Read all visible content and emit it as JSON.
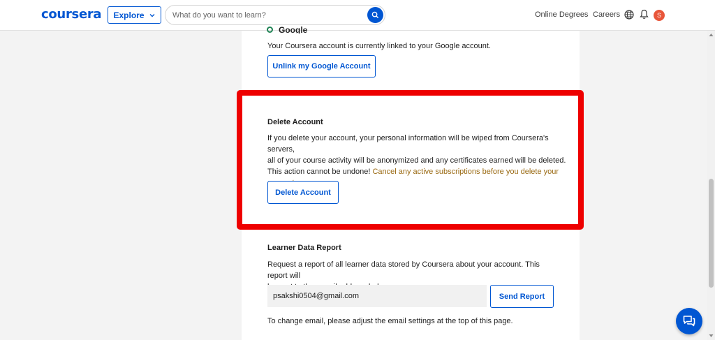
{
  "header": {
    "logo": "coursera",
    "explore_label": "Explore",
    "search_placeholder": "What do you want to learn?",
    "nav": {
      "online_degrees": "Online Degrees",
      "careers": "Careers"
    },
    "avatar_initial": "S"
  },
  "google_section": {
    "provider": "Google",
    "linked_text": "Your Coursera account is currently linked to your Google account.",
    "unlink_label": "Unlink my Google Account"
  },
  "delete_section": {
    "title": "Delete Account",
    "desc_line1": "If you delete your account, your personal information will be wiped from Coursera's servers,",
    "desc_line2": "all of your course activity will be anonymized and any certificates earned will be deleted.",
    "desc_line3": "This action cannot be undone! ",
    "desc_warning": "Cancel any active subscriptions before you delete your account.",
    "button_label": "Delete Account"
  },
  "report_section": {
    "title": "Learner Data Report",
    "desc_line1": "Request a report of all learner data stored by Coursera about your account. This report will",
    "desc_line2": "be sent to the e-mail address below.",
    "email_value": "psakshi0504@gmail.com",
    "send_label": "Send Report",
    "change_email_text": "To change email, please adjust the email settings at the top of this page."
  },
  "colors": {
    "brand": "#0056d2",
    "highlight": "#ee0000",
    "warning_text": "#9a6a13",
    "avatar_bg": "#e8563a"
  },
  "icons": {
    "explore": "chevron-down-icon",
    "search": "search-icon",
    "globe": "globe-icon",
    "notifications": "bell-icon",
    "google_status": "check-circle-icon",
    "chat": "chat-icon"
  }
}
